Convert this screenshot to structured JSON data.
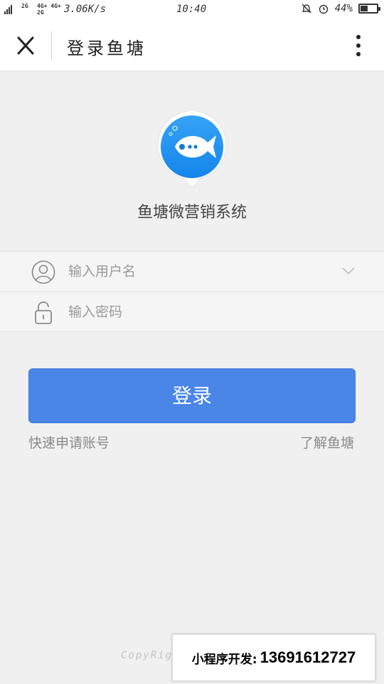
{
  "status_bar": {
    "network_1": "2G",
    "network_2": "4G+",
    "network_3": "4G+",
    "network_4": "2G",
    "speed": "3.06K/s",
    "time": "10:40",
    "battery_text": "44%",
    "battery_level": 0.44
  },
  "nav": {
    "title": "登录鱼塘"
  },
  "app": {
    "name": "鱼塘微营销系统"
  },
  "form": {
    "username_placeholder": "输入用户名",
    "password_placeholder": "输入密码",
    "username_value": "",
    "password_value": ""
  },
  "actions": {
    "login_label": "登录",
    "register_link": "快速申请账号",
    "about_link": "了解鱼塘"
  },
  "footer": {
    "copyright": "CopyRigh"
  },
  "promo": {
    "label": "小程序开发:",
    "phone": "13691612727"
  },
  "colors": {
    "primary": "#4a86e8",
    "background": "#f0f0f0",
    "logo_blue": "#1e90ff"
  }
}
